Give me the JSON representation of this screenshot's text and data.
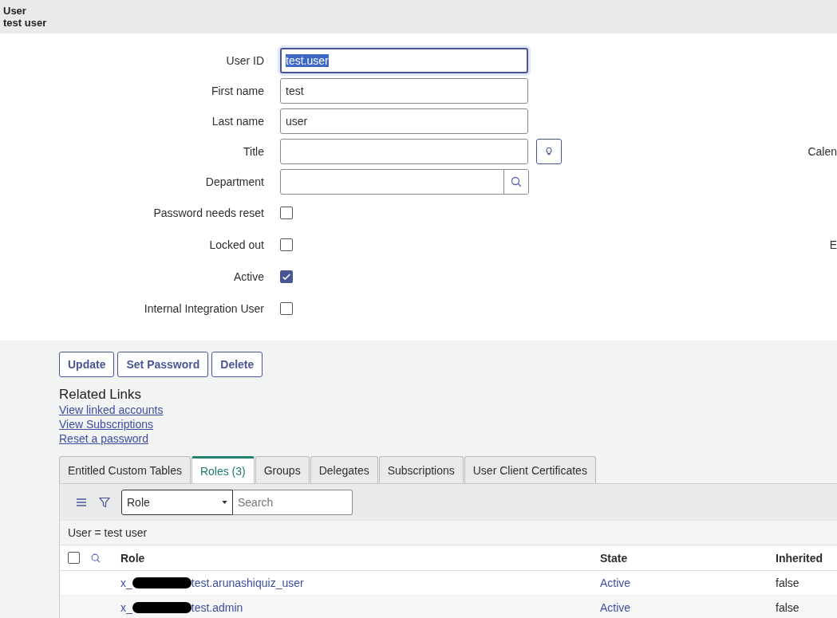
{
  "header": {
    "table": "User",
    "record": "test user"
  },
  "fields": [
    {
      "label": "User ID",
      "kind": "text",
      "value": "test.user",
      "focused": true
    },
    {
      "label": "First name",
      "kind": "text",
      "value": "test"
    },
    {
      "label": "Last name",
      "kind": "text",
      "value": "user"
    },
    {
      "label": "Title",
      "kind": "suggest",
      "right_label": "Calen"
    },
    {
      "label": "Department",
      "kind": "reference"
    },
    {
      "label": "Password needs reset",
      "kind": "checkbox",
      "checked": false
    },
    {
      "label": "Locked out",
      "kind": "checkbox",
      "checked": false,
      "right_label": "E"
    },
    {
      "label": "Active",
      "kind": "checkbox",
      "checked": true
    },
    {
      "label": "Internal Integration User",
      "kind": "checkbox",
      "checked": false
    }
  ],
  "buttons": [
    "Update",
    "Set Password",
    "Delete"
  ],
  "related_links": {
    "title": "Related Links",
    "links": [
      "View linked accounts",
      "View Subscriptions",
      "Reset a password"
    ]
  },
  "tabs": [
    {
      "label": "Entitled Custom Tables",
      "selected": false
    },
    {
      "label": "Roles (3)",
      "selected": true
    },
    {
      "label": "Groups",
      "selected": false
    },
    {
      "label": "Delegates",
      "selected": false
    },
    {
      "label": "Subscriptions",
      "selected": false
    },
    {
      "label": "User Client Certificates",
      "selected": false
    }
  ],
  "list": {
    "search_field": "Role",
    "search_placeholder": "Search",
    "breadcrumb": "User = test user",
    "select_all_checked": false,
    "columns": [
      "Role",
      "State",
      "Inherited"
    ],
    "rows": [
      {
        "role_prefix": "x_",
        "role_suffix": "test.arunashiquiz_user",
        "state": "Active",
        "inherited": "false"
      },
      {
        "role_prefix": "x_",
        "role_suffix": "test.admin",
        "state": "Active",
        "inherited": "false"
      }
    ]
  }
}
